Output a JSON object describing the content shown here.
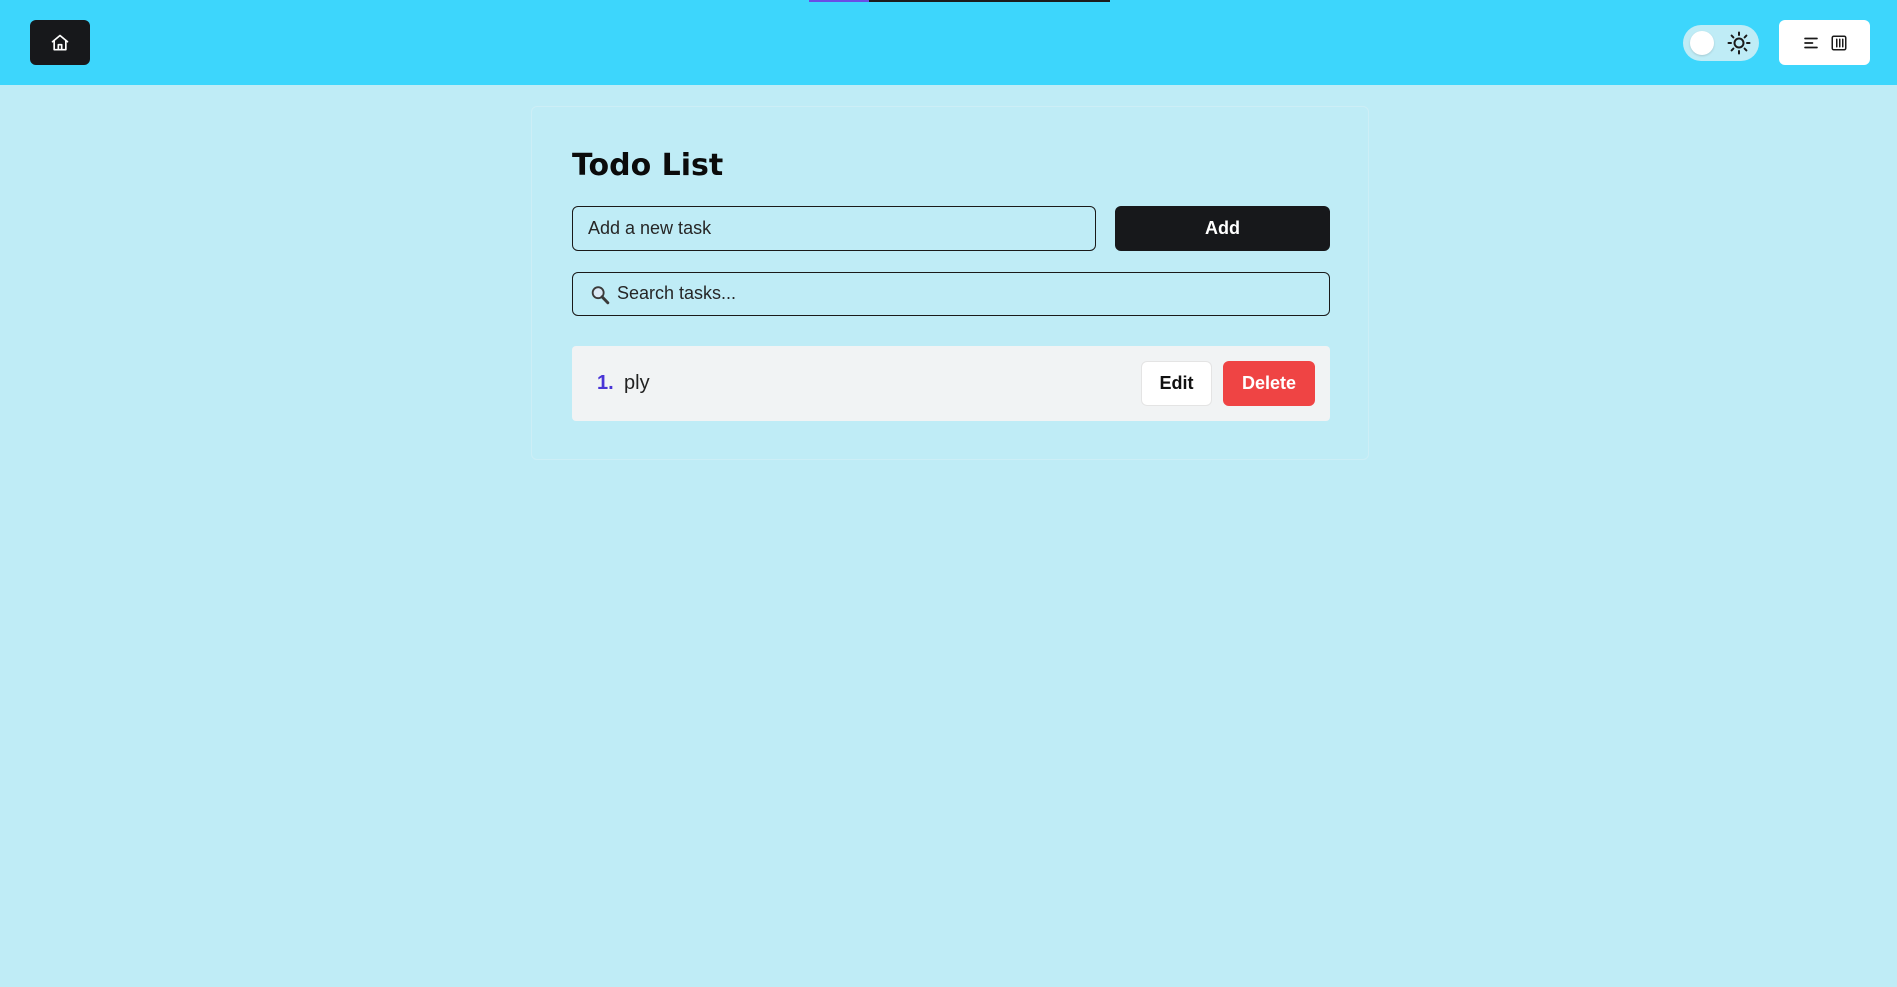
{
  "header": {
    "scroll_progress": 0.2,
    "home_icon": "home-icon",
    "theme_toggle": {
      "state": "light",
      "icon": "sun-icon"
    },
    "layout_button": {
      "icons": [
        "align-left-icon",
        "columns-icon"
      ]
    }
  },
  "main": {
    "title": "Todo List",
    "new_task": {
      "placeholder": "Add a new task",
      "value": ""
    },
    "add_label": "Add",
    "search": {
      "placeholder": "Search tasks...",
      "value": "",
      "icon": "magnifier-icon"
    },
    "tasks": [
      {
        "number": "1.",
        "text": "ply",
        "edit_label": "Edit",
        "delete_label": "Delete"
      }
    ]
  },
  "colors": {
    "header_bg": "#3dd6fc",
    "page_bg": "#bfecf6",
    "primary_button": "#17181b",
    "delete_button": "#ef4444",
    "task_number": "#4934d6",
    "task_row_bg": "#f1f3f4"
  }
}
